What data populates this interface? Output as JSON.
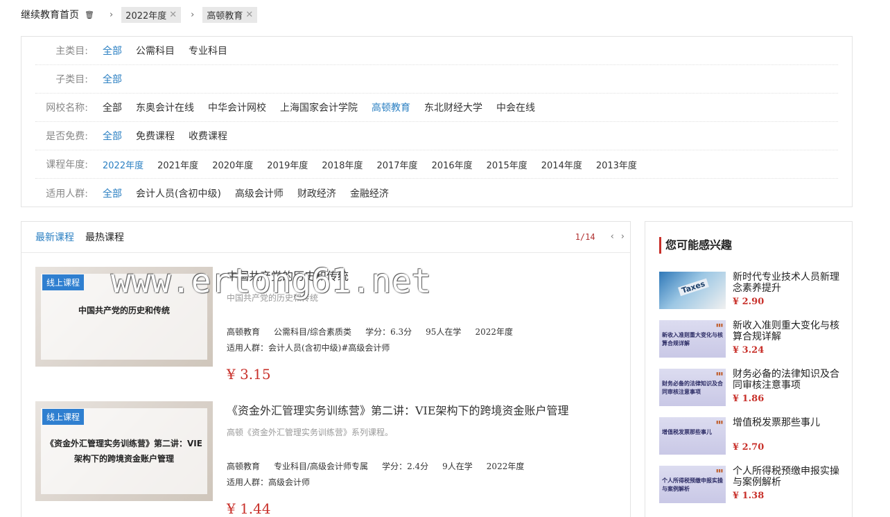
{
  "breadcrumb": {
    "home": "继续教育首页",
    "tags": [
      "2022年度",
      "高顿教育"
    ]
  },
  "filters": [
    {
      "label": "主类目:",
      "options": [
        "全部",
        "公需科目",
        "专业科目"
      ],
      "active": 0
    },
    {
      "label": "子类目:",
      "options": [
        "全部"
      ],
      "active": 0
    },
    {
      "label": "网校名称:",
      "options": [
        "全部",
        "东奥会计在线",
        "中华会计网校",
        "上海国家会计学院",
        "高顿教育",
        "东北财经大学",
        "中会在线"
      ],
      "active": 4
    },
    {
      "label": "是否免费:",
      "options": [
        "全部",
        "免费课程",
        "收费课程"
      ],
      "active": 0
    },
    {
      "label": "课程年度:",
      "options": [
        "2022年度",
        "2021年度",
        "2020年度",
        "2019年度",
        "2018年度",
        "2017年度",
        "2016年度",
        "2015年度",
        "2014年度",
        "2013年度"
      ],
      "active": 0
    },
    {
      "label": "适用人群:",
      "options": [
        "全部",
        "会计人员(含初中级)",
        "高级会计师",
        "财政经济",
        "金融经济"
      ],
      "active": 0
    }
  ],
  "tabs": [
    "最新课程",
    "最热课程"
  ],
  "pager": {
    "text": "1/14",
    "prev": "‹",
    "next": "›"
  },
  "courses": [
    {
      "badge": "线上课程",
      "thumb_title": "中国共产党的历史和传统",
      "title": "中国共产党的历史和传统",
      "subtitle": "中国共产党的历史和传统",
      "school": "高顿教育",
      "category": "公需科目/综合素质类",
      "credit": "学分：6.3分",
      "learners": "95人在学",
      "year": "2022年度",
      "audience": "适用人群：会计人员(含初中级)#高级会计师",
      "price": "¥ 3.15"
    },
    {
      "badge": "线上课程",
      "thumb_title": "《资金外汇管理实务训练营》第二讲：VIE架构下的跨境资金账户管理",
      "title": "《资金外汇管理实务训练营》第二讲：VIE架构下的跨境资金账户管理",
      "subtitle": "高顿《资金外汇管理实务训练营》系列课程。",
      "school": "高顿教育",
      "category": "专业科目/高级会计师专属",
      "credit": "学分：2.4分",
      "learners": "9人在学",
      "year": "2022年度",
      "audience": "适用人群：高级会计师",
      "price": "¥ 1.44"
    }
  ],
  "watermark": "www.ertong61.net",
  "sidebar": {
    "title": "您可能感兴趣",
    "items": [
      {
        "name": "新时代专业技术人员新理念素养提升",
        "price": "¥  2.90",
        "thumb_text": "Taxes"
      },
      {
        "name": "新收入准则重大变化与核算合规详解",
        "price": "¥  3.24",
        "thumb_text": "新收入准则重大变化与核算合规详解"
      },
      {
        "name": "财务必备的法律知识及合同审核注意事项",
        "price": "¥  1.86",
        "thumb_text": "财务必备的法律知识及合同审核注意事项"
      },
      {
        "name": "增值税发票那些事儿",
        "price": "¥  2.70",
        "thumb_text": "增值税发票那些事儿"
      },
      {
        "name": "个人所得税预缴申报实操与案例解析",
        "price": "¥  1.38",
        "thumb_text": "个人所得税预缴申报实操与案例解析"
      }
    ]
  }
}
